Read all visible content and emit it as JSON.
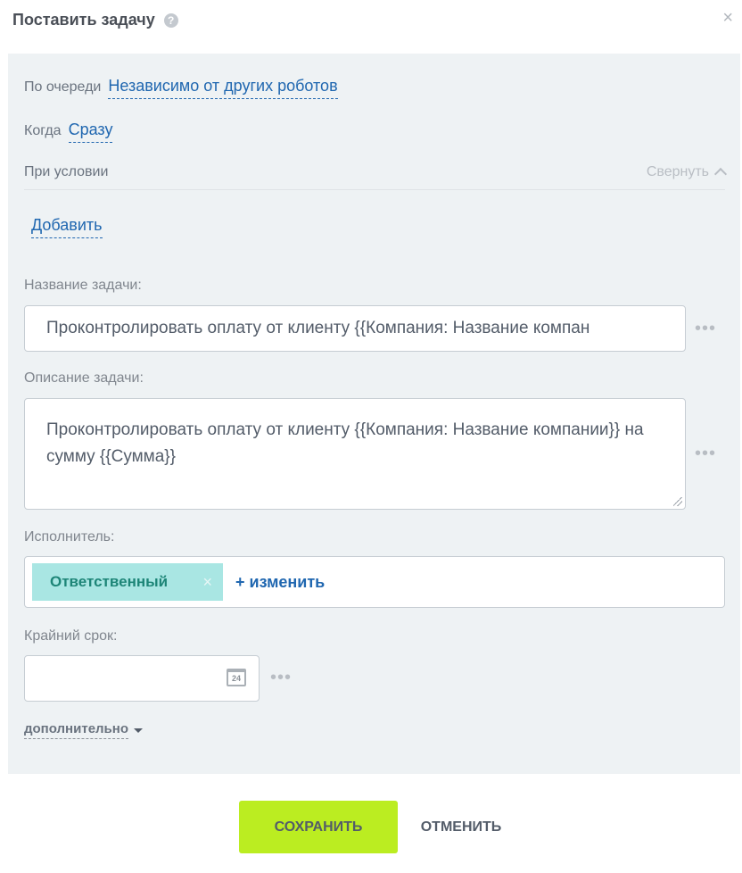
{
  "dialog": {
    "title": "Поставить задачу",
    "help_glyph": "?",
    "close_glyph": "×"
  },
  "queue": {
    "label": "По очереди",
    "value": "Независимо от других роботов"
  },
  "when": {
    "label": "Когда",
    "value": "Сразу"
  },
  "condition": {
    "label": "При условии",
    "collapse_label": "Свернуть",
    "add_label": "Добавить"
  },
  "task_name": {
    "label": "Название задачи:",
    "value": "Проконтролировать оплату от клиенту {{Компания: Название компан"
  },
  "task_description": {
    "label": "Описание задачи:",
    "value": "Проконтролировать оплату от клиенту {{Компания: Название компании}} на сумму {{Сумма}}"
  },
  "assignee": {
    "label": "Исполнитель:",
    "tag": "Ответственный",
    "tag_close": "×",
    "change_label": "+ изменить"
  },
  "deadline": {
    "label": "Крайний срок:",
    "calendar_day": "24"
  },
  "more_dots": "•••",
  "additional": {
    "label": "дополнительно"
  },
  "footer": {
    "save_label": "СОХРАНИТЬ",
    "cancel_label": "ОТМЕНИТЬ"
  },
  "colors": {
    "accent": "#bbed21",
    "link": "#2067b0",
    "panel_bg": "#eef2f4",
    "tag_bg": "#a9e6e3"
  }
}
